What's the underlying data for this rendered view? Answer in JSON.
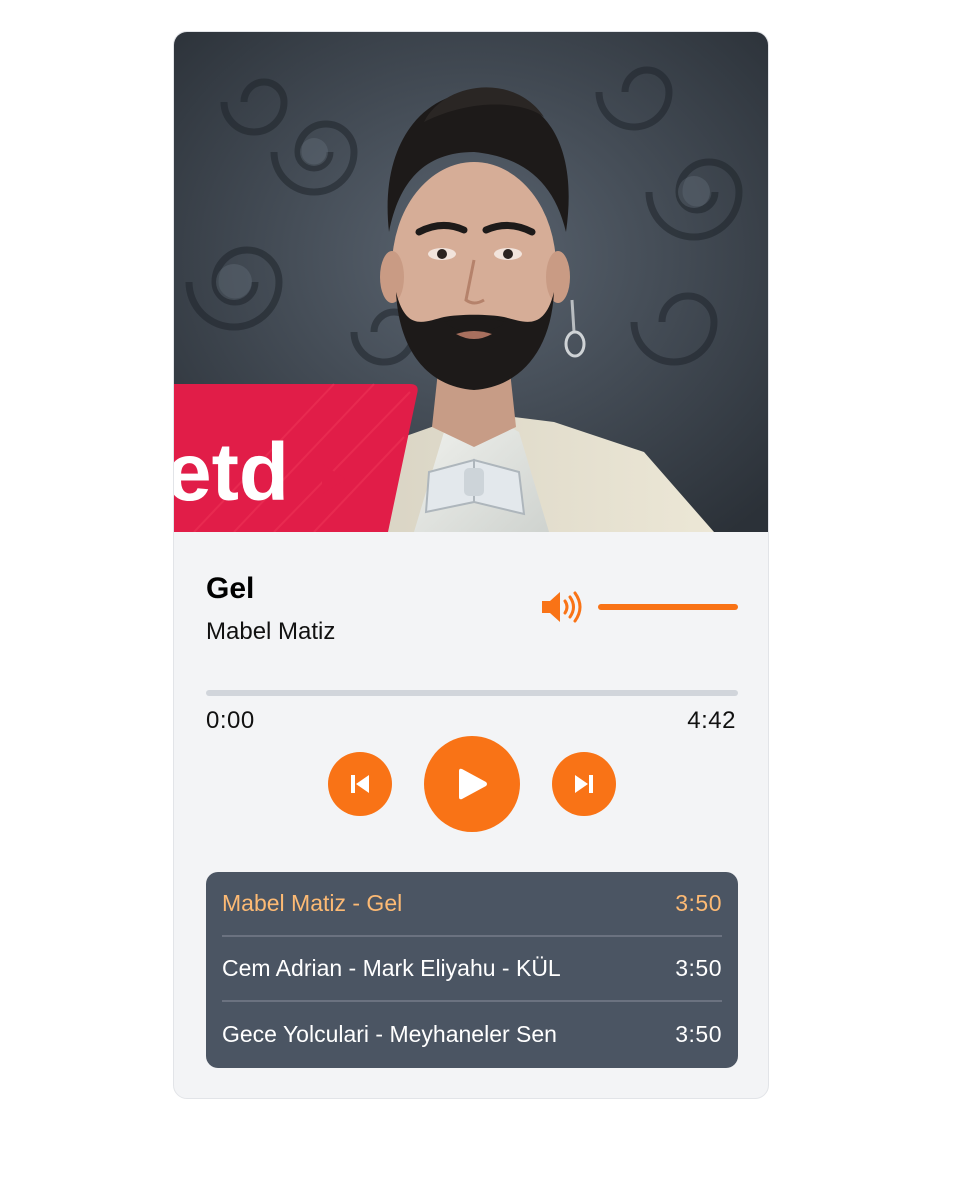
{
  "track": {
    "title": "Gel",
    "artist": "Mabel Matiz"
  },
  "cover": {
    "badge_text": "etd"
  },
  "volume": {
    "icon": "volume-high-icon",
    "level": 1.0
  },
  "progress": {
    "current": "0:00",
    "total": "4:42",
    "fraction": 0
  },
  "controls": {
    "previous_icon": "skip-previous-icon",
    "play_icon": "play-icon",
    "next_icon": "skip-next-icon"
  },
  "playlist": {
    "items": [
      {
        "label": "Mabel Matiz - Gel",
        "duration": "3:50",
        "active": true
      },
      {
        "label": "Cem Adrian - Mark Eliyahu - KÜL",
        "duration": "3:50",
        "active": false
      },
      {
        "label": "Gece Yolculari - Meyhaneler Sen",
        "duration": "3:50",
        "active": false
      }
    ]
  },
  "colors": {
    "accent": "#f97316",
    "active_track": "#fdba74",
    "playlist_bg": "#4b5563",
    "card_bg": "#f3f4f6",
    "badge_red": "#e11d48"
  }
}
